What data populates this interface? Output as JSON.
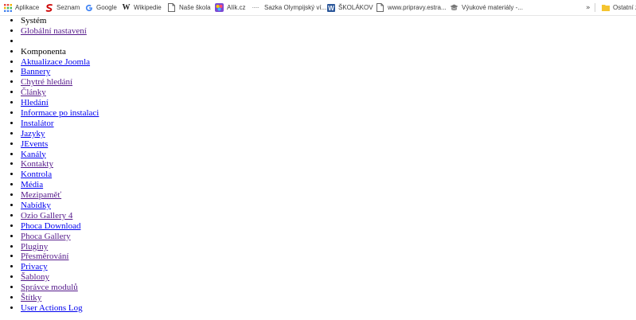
{
  "bookmarks": {
    "items": [
      {
        "label": "Aplikace",
        "icon": "apps-grid-icon"
      },
      {
        "label": "Seznam",
        "icon": "seznam-icon"
      },
      {
        "label": "Google",
        "icon": "google-icon"
      },
      {
        "label": "Wikipedie",
        "icon": "wikipedia-icon"
      },
      {
        "label": "Naše škola",
        "icon": "page-icon"
      },
      {
        "label": "Alík.cz",
        "icon": "alik-icon"
      },
      {
        "label": "Sazka Olympijský ví...",
        "icon": "sazka-icon"
      },
      {
        "label": "ŠKOLÁKOV",
        "icon": "word-icon"
      },
      {
        "label": "www.pripravy.estra...",
        "icon": "page-icon"
      },
      {
        "label": "Výukové materiály -...",
        "icon": "materials-icon"
      }
    ],
    "overflow": "»",
    "other": "Ostatní z"
  },
  "menu": {
    "system_heading": "Systém",
    "global_settings": "Globální nastavení",
    "component_heading": "Komponenta",
    "components": [
      "Aktualizace Joomla",
      "Bannery",
      "Chytré hledání",
      "Články",
      "Hledání",
      "Informace po instalaci",
      "Instalátor",
      "Jazyky",
      "JEvents",
      "Kanály",
      "Kontakty",
      "Kontrola",
      "Média",
      "Mezipaměť",
      "Nabídky",
      "Ozio Gallery 4",
      "Phoca Download",
      "Phoca Gallery",
      "Pluginy",
      "Přesměrování",
      "Privacy",
      "Šablony",
      "Správce modulů",
      "Štítky",
      "User Actions Log"
    ]
  },
  "colors": {
    "link": "#0000ee",
    "visited": "#551a8b",
    "text": "#000000"
  }
}
